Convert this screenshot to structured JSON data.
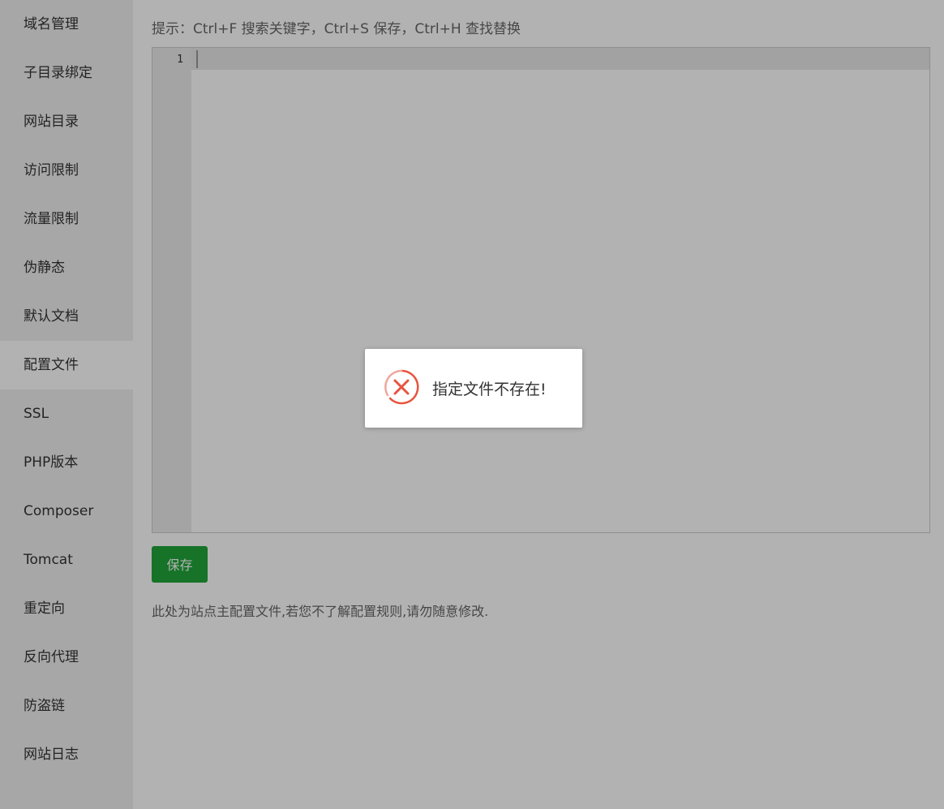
{
  "sidebar": {
    "items": [
      {
        "label": "域名管理"
      },
      {
        "label": "子目录绑定"
      },
      {
        "label": "网站目录"
      },
      {
        "label": "访问限制"
      },
      {
        "label": "流量限制"
      },
      {
        "label": "伪静态"
      },
      {
        "label": "默认文档"
      },
      {
        "label": "配置文件",
        "active": true
      },
      {
        "label": "SSL"
      },
      {
        "label": "PHP版本"
      },
      {
        "label": "Composer"
      },
      {
        "label": "Tomcat"
      },
      {
        "label": "重定向"
      },
      {
        "label": "反向代理"
      },
      {
        "label": "防盗链"
      },
      {
        "label": "网站日志"
      }
    ]
  },
  "main": {
    "tip": "提示：Ctrl+F 搜索关键字，Ctrl+S 保存，Ctrl+H 查找替换",
    "editor": {
      "line_number": "1",
      "content": ""
    },
    "save_label": "保存",
    "note": "此处为站点主配置文件,若您不了解配置规则,请勿随意修改."
  },
  "toast": {
    "icon": "error-circle-icon",
    "message": "指定文件不存在!"
  },
  "colors": {
    "accent": "#20a53a",
    "error": "#e8543f",
    "overlay": "rgba(0,0,0,0.30)"
  }
}
